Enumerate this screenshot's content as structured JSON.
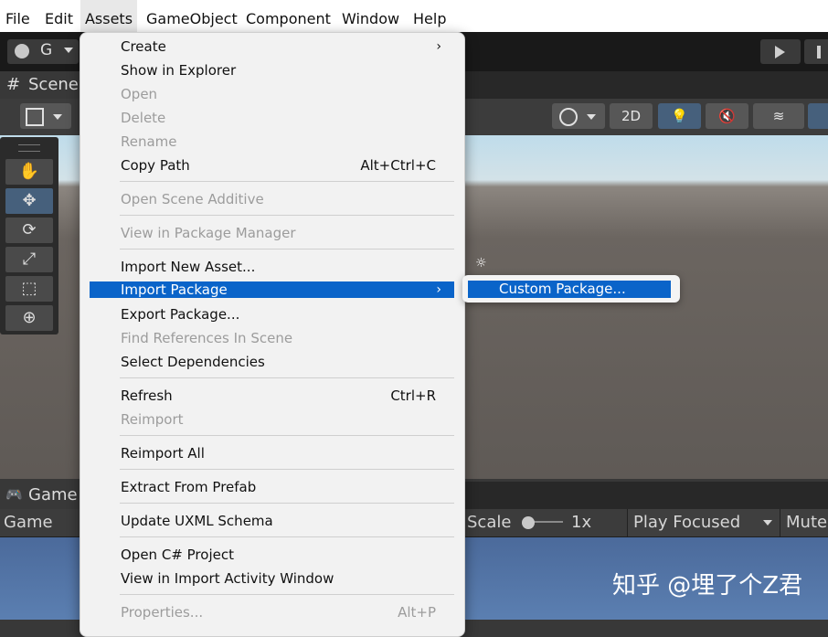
{
  "menubar": {
    "items": [
      {
        "label": "File"
      },
      {
        "label": "Edit"
      },
      {
        "label": "Assets"
      },
      {
        "label": "GameObject"
      },
      {
        "label": "Component"
      },
      {
        "label": "Window"
      },
      {
        "label": "Help"
      }
    ],
    "active": "Assets"
  },
  "toolbar": {
    "account_label": "G"
  },
  "scene": {
    "tab_label": "Scene",
    "view_mode_2d": "2D"
  },
  "game": {
    "tab_label": "Game",
    "display_label": "Game",
    "scale_label": "Scale",
    "scale_value": "1x",
    "play_mode": "Play Focused",
    "mute_label": "Mute"
  },
  "assets_menu": {
    "items": [
      {
        "label": "Create",
        "shortcut": "",
        "enabled": true,
        "submenu": true
      },
      {
        "label": "Show in Explorer",
        "shortcut": "",
        "enabled": true
      },
      {
        "label": "Open",
        "shortcut": "",
        "enabled": false
      },
      {
        "label": "Delete",
        "shortcut": "",
        "enabled": false
      },
      {
        "label": "Rename",
        "shortcut": "",
        "enabled": false
      },
      {
        "label": "Copy Path",
        "shortcut": "Alt+Ctrl+C",
        "enabled": true
      },
      {
        "label": "Open Scene Additive",
        "shortcut": "",
        "enabled": false
      },
      {
        "label": "View in Package Manager",
        "shortcut": "",
        "enabled": false
      },
      {
        "label": "Import New Asset...",
        "shortcut": "",
        "enabled": true
      },
      {
        "label": "Import Package",
        "shortcut": "",
        "enabled": true,
        "submenu": true,
        "highlighted": true
      },
      {
        "label": "Export Package...",
        "shortcut": "",
        "enabled": true
      },
      {
        "label": "Find References In Scene",
        "shortcut": "",
        "enabled": false
      },
      {
        "label": "Select Dependencies",
        "shortcut": "",
        "enabled": true
      },
      {
        "label": "Refresh",
        "shortcut": "Ctrl+R",
        "enabled": true
      },
      {
        "label": "Reimport",
        "shortcut": "",
        "enabled": false
      },
      {
        "label": "Reimport All",
        "shortcut": "",
        "enabled": true
      },
      {
        "label": "Extract From Prefab",
        "shortcut": "",
        "enabled": true
      },
      {
        "label": "Update UXML Schema",
        "shortcut": "",
        "enabled": true
      },
      {
        "label": "Open C# Project",
        "shortcut": "",
        "enabled": true
      },
      {
        "label": "View in Import Activity Window",
        "shortcut": "",
        "enabled": true
      },
      {
        "label": "Properties...",
        "shortcut": "Alt+P",
        "enabled": false
      }
    ]
  },
  "import_package_submenu": {
    "items": [
      {
        "label": "Custom Package...",
        "highlighted": true
      }
    ]
  },
  "watermark": "知乎 @埋了个Z君",
  "colors": {
    "highlight": "#0a64c9",
    "menu_bg": "#f2f2f2",
    "disabled_text": "#9c9c9c"
  }
}
